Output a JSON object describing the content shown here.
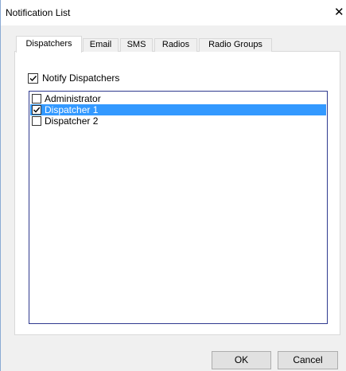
{
  "window": {
    "title": "Notification List",
    "close_glyph": "✕"
  },
  "tabs": [
    {
      "label": "Dispatchers",
      "active": true
    },
    {
      "label": "Email",
      "active": false
    },
    {
      "label": "SMS",
      "active": false
    },
    {
      "label": "Radios",
      "active": false
    },
    {
      "label": "Radio Groups",
      "active": false
    }
  ],
  "notify": {
    "label": "Notify Dispatchers",
    "checked": true
  },
  "list": {
    "items": [
      {
        "label": "Administrator",
        "checked": false,
        "selected": false
      },
      {
        "label": "Dispatcher 1",
        "checked": true,
        "selected": true
      },
      {
        "label": "Dispatcher 2",
        "checked": false,
        "selected": false
      }
    ]
  },
  "buttons": {
    "ok_label": "OK",
    "cancel_label": "Cancel"
  },
  "colors": {
    "selection": "#3399ff",
    "list_border": "#2f3a8f"
  },
  "icons": {
    "close": "close-icon",
    "check": "checkmark-icon"
  }
}
